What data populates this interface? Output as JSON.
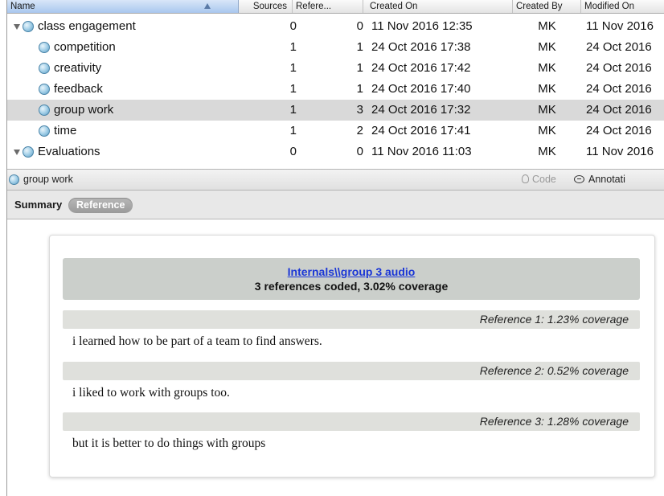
{
  "columns": {
    "name": "Name",
    "sources": "Sources",
    "references": "Refere...",
    "created_on": "Created On",
    "created_by": "Created By",
    "modified_on": "Modified On"
  },
  "nodes": [
    {
      "name": "class engagement",
      "sources": "0",
      "references": "0",
      "created_on": "11 Nov 2016 12:35",
      "created_by": "MK",
      "modified_on": "11 Nov 2016",
      "expanded": true,
      "level": 0,
      "selected": false
    },
    {
      "name": "competition",
      "sources": "1",
      "references": "1",
      "created_on": "24 Oct 2016 17:38",
      "created_by": "MK",
      "modified_on": "24 Oct 2016",
      "level": 1,
      "selected": false
    },
    {
      "name": "creativity",
      "sources": "1",
      "references": "1",
      "created_on": "24 Oct 2016 17:42",
      "created_by": "MK",
      "modified_on": "24 Oct 2016",
      "level": 1,
      "selected": false
    },
    {
      "name": "feedback",
      "sources": "1",
      "references": "1",
      "created_on": "24 Oct 2016 17:40",
      "created_by": "MK",
      "modified_on": "24 Oct 2016",
      "level": 1,
      "selected": false
    },
    {
      "name": "group work",
      "sources": "1",
      "references": "3",
      "created_on": "24 Oct 2016 17:32",
      "created_by": "MK",
      "modified_on": "24 Oct 2016",
      "level": 1,
      "selected": true
    },
    {
      "name": "time",
      "sources": "1",
      "references": "2",
      "created_on": "24 Oct 2016 17:41",
      "created_by": "MK",
      "modified_on": "24 Oct 2016",
      "level": 1,
      "selected": false
    },
    {
      "name": "Evaluations",
      "sources": "0",
      "references": "0",
      "created_on": "11 Nov 2016 11:03",
      "created_by": "MK",
      "modified_on": "11 Nov 2016",
      "expanded": true,
      "level": 0,
      "selected": false
    }
  ],
  "detail": {
    "title": "group work",
    "code_label": "Code",
    "annotations_label": "Annotati"
  },
  "tabs": {
    "summary": "Summary",
    "reference": "Reference",
    "active": "reference"
  },
  "reference_view": {
    "source_link": "Internals\\\\group 3 audio",
    "coverage_summary": "3 references coded, 3.02% coverage",
    "references": [
      {
        "label": "Reference 1: 1.23% coverage",
        "text": "i learned how to be part of a team to find answers."
      },
      {
        "label": "Reference 2: 0.52% coverage",
        "text": "i liked to work with groups too."
      },
      {
        "label": "Reference 3: 1.28% coverage",
        "text": "but it is better to do things with groups"
      }
    ]
  },
  "colors": {
    "selected_row": "#d9d9d9",
    "node_icon": "#7fb8da",
    "link": "#1a36d6",
    "reference_bar": "#dfe0dc",
    "card_header": "#cbcfcb"
  }
}
